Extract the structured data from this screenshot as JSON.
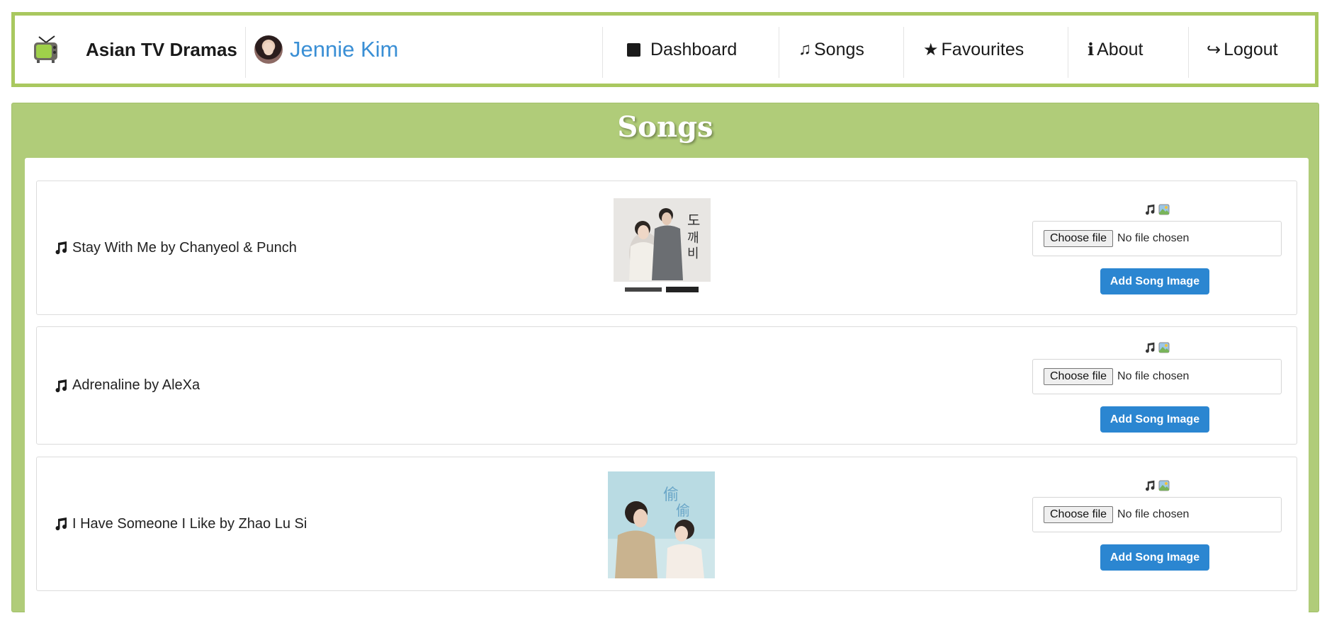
{
  "navbar": {
    "brand_title": "Asian TV Dramas",
    "brand_icon": "tv-icon",
    "user_name": "Jennie Kim",
    "links": [
      {
        "label": "Dashboard",
        "icon": "square-icon"
      },
      {
        "label": "Songs",
        "icon": "♫"
      },
      {
        "label": "Favourites",
        "icon": "★"
      },
      {
        "label": "About",
        "icon": "ℹ"
      },
      {
        "label": "Logout",
        "icon": "↪"
      }
    ]
  },
  "panel": {
    "title": "Songs"
  },
  "songs": [
    {
      "title": "Stay With Me by Chanyeol & Punch",
      "has_cover": true
    },
    {
      "title": "Adrenaline by AleXa",
      "has_cover": false
    },
    {
      "title": "I Have Someone I Like by Zhao Lu Si",
      "has_cover": true
    }
  ],
  "upload": {
    "choose_label": "Choose file",
    "no_file": "No file chosen",
    "add_button": "Add Song Image",
    "emoji": [
      "music-note-icon",
      "picture-icon"
    ]
  },
  "colors": {
    "accent_green": "#b0cc79",
    "border_green": "#a9c85f",
    "button_blue": "#2b86d1",
    "user_blue": "#3a8fd5"
  }
}
